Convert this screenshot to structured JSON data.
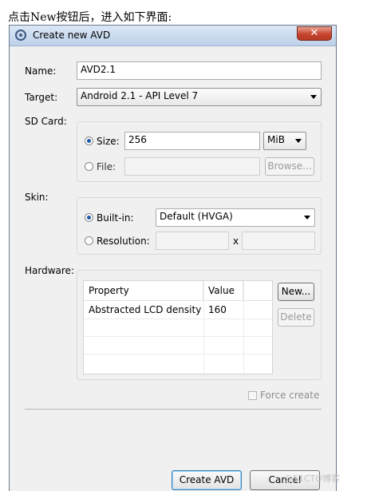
{
  "caption": "点击New按钮后，进入如下界面:",
  "window": {
    "title": "Create new AVD",
    "close_glyph": "✕"
  },
  "form": {
    "name_label": "Name:",
    "name_value": "AVD2.1",
    "target_label": "Target:",
    "target_value": "Android 2.1 - API Level 7",
    "sdcard_label": "SD Card:",
    "size_label": "Size:",
    "size_value": "256",
    "size_unit": "MiB",
    "file_label": "File:",
    "file_value": "",
    "browse_label": "Browse...",
    "skin_label": "Skin:",
    "builtin_label": "Built-in:",
    "builtin_value": "Default (HVGA)",
    "resolution_label": "Resolution:",
    "resolution_x": "x",
    "hardware_label": "Hardware:"
  },
  "hardware_table": {
    "columns": [
      "Property",
      "Value"
    ],
    "rows": [
      {
        "property": "Abstracted LCD density",
        "value": "160"
      }
    ]
  },
  "buttons": {
    "new": "New...",
    "delete": "Delete",
    "force_create": "Force create",
    "create_avd": "Create AVD",
    "cancel": "Cancel"
  },
  "watermark": "@51CTO博客",
  "icons": {
    "app": "android-avd-icon",
    "close": "close-icon",
    "dropdown": "chevron-down-icon"
  }
}
